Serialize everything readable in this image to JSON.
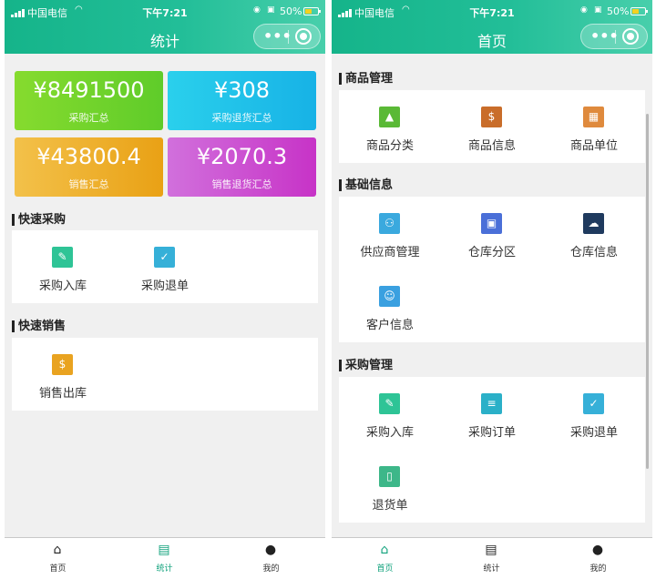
{
  "status": {
    "carrier": "中国电信",
    "time": "下午7:21",
    "battery": "50%"
  },
  "colors": {
    "nav_gradient": "#1cb890",
    "tab_active": "#11a27c"
  },
  "left": {
    "title": "统计",
    "cards": [
      {
        "value": "¥8491500",
        "label": "采购汇总",
        "color": "#7bd62b"
      },
      {
        "value": "¥308",
        "label": "采购退货汇总",
        "color": "#1ec3ea"
      },
      {
        "value": "¥43800.4",
        "label": "销售汇总",
        "color": "#f2b021"
      },
      {
        "value": "¥2070.3",
        "label": "销售退货汇总",
        "color": "#d24fd0"
      }
    ],
    "sections": [
      {
        "title": "快速采购",
        "items": [
          {
            "label": "采购入库",
            "icon": "pencil-icon"
          },
          {
            "label": "采购退单",
            "icon": "return-bag-icon"
          }
        ]
      },
      {
        "title": "快速销售",
        "items": [
          {
            "label": "销售出库",
            "icon": "outbound-doc-icon"
          }
        ]
      }
    ],
    "active_tab": "统计"
  },
  "right": {
    "title": "首页",
    "sections": [
      {
        "title": "商品管理",
        "items": [
          {
            "label": "商品分类",
            "icon": "category-icon"
          },
          {
            "label": "商品信息",
            "icon": "product-info-icon"
          },
          {
            "label": "商品单位",
            "icon": "unit-icon"
          }
        ]
      },
      {
        "title": "基础信息",
        "items": [
          {
            "label": "供应商管理",
            "icon": "supplier-icon"
          },
          {
            "label": "仓库分区",
            "icon": "zone-icon"
          },
          {
            "label": "仓库信息",
            "icon": "cloud-icon"
          },
          {
            "label": "客户信息",
            "icon": "customer-icon"
          }
        ]
      },
      {
        "title": "采购管理",
        "items": [
          {
            "label": "采购入库",
            "icon": "pencil-icon"
          },
          {
            "label": "采购订单",
            "icon": "order-icon"
          },
          {
            "label": "采购退单",
            "icon": "return-bag-icon"
          },
          {
            "label": "退货单",
            "icon": "return-doc-icon"
          }
        ]
      }
    ],
    "active_tab": "首页"
  },
  "tabbar": [
    {
      "label": "首页",
      "icon": "home-icon"
    },
    {
      "label": "统计",
      "icon": "stats-icon"
    },
    {
      "label": "我的",
      "icon": "profile-icon"
    }
  ]
}
